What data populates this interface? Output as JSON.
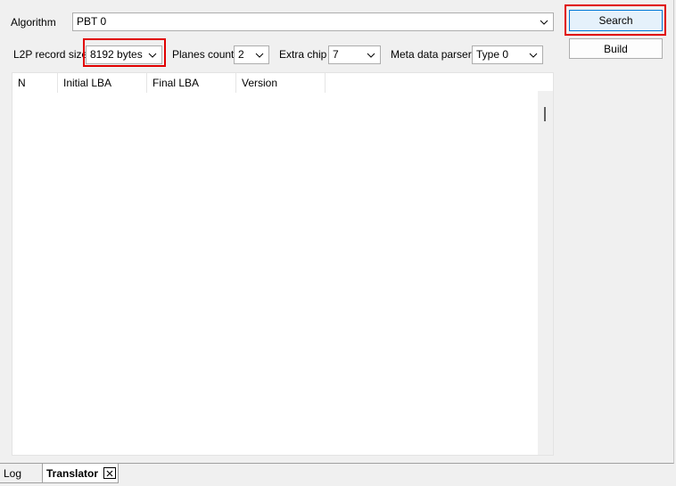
{
  "algorithm": {
    "label": "Algorithm",
    "value": "PBT 0"
  },
  "settings": {
    "l2p_label": "L2P record size",
    "l2p_value": "8192 bytes",
    "planes_label": "Planes count",
    "planes_value": "2",
    "extra_chip_label": "Extra chip",
    "extra_chip_value": "7",
    "meta_label": "Meta data parser",
    "meta_value": "Type 0"
  },
  "actions": {
    "search_label": "Search",
    "build_label": "Build"
  },
  "table": {
    "columns": [
      "N",
      "Initial LBA",
      "Final LBA",
      "Version"
    ]
  },
  "tabs": [
    {
      "label": "Log"
    },
    {
      "label": "Translator"
    }
  ],
  "icons": {
    "dropdown": "chevron-down-icon",
    "close": "close-icon"
  },
  "colors": {
    "highlight": "#e00000",
    "primary_button_bg": "#e5f1fb",
    "primary_button_border": "#0078d7"
  }
}
